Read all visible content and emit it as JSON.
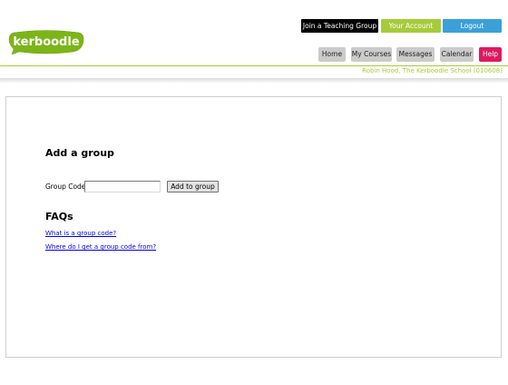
{
  "brand": {
    "logo_text": "kerboodle",
    "logo_color": "#7cb518",
    "accent": "#a6cb3a"
  },
  "top_bar": {
    "join_label": "Join a Teaching Group",
    "account_label": "Your Account",
    "logout_label": "Logout"
  },
  "nav": {
    "items": [
      {
        "label": "Home"
      },
      {
        "label": "My Courses"
      },
      {
        "label": "Messages"
      },
      {
        "label": "Calendar"
      },
      {
        "label": "Help"
      }
    ]
  },
  "user": {
    "info": "Robin Hood, The Kerboodle School (010608)"
  },
  "main": {
    "title": "Add a group",
    "group_code_label": "Group Code:",
    "group_code_value": "",
    "add_button_label": "Add to group",
    "faq_title": "FAQs",
    "faq_links": [
      {
        "label": "What is a group code?"
      },
      {
        "label": "Where do I get a group code from?"
      }
    ]
  }
}
